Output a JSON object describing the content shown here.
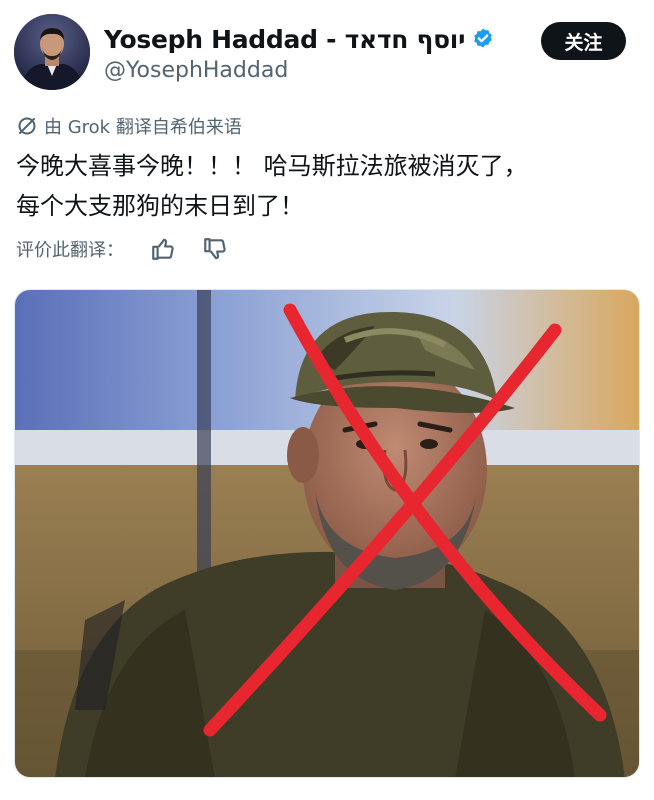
{
  "author": {
    "display_name": "Yoseph Haddad - יוסף חדאד",
    "handle": "@YosephHaddad",
    "verified": true,
    "verified_color": "#1d9bf0"
  },
  "follow_label": "关注",
  "translation_note": "由 Grok 翻译自希伯来语",
  "tweet": {
    "line1": "今晚大喜事今晚！！！ 哈马斯拉法旅被消灭了，",
    "line2": "每个大支那狗的末日到了！"
  },
  "rate": {
    "label": "评价此翻译：",
    "icons": [
      "thumbs-up-icon",
      "thumbs-down-icon"
    ]
  },
  "media": {
    "type": "photo",
    "overlay": "red-x-mark",
    "overlay_color": "#e8262f"
  },
  "colors": {
    "text": "#0f1419",
    "secondary": "#536471",
    "button_bg": "#0f1419"
  }
}
